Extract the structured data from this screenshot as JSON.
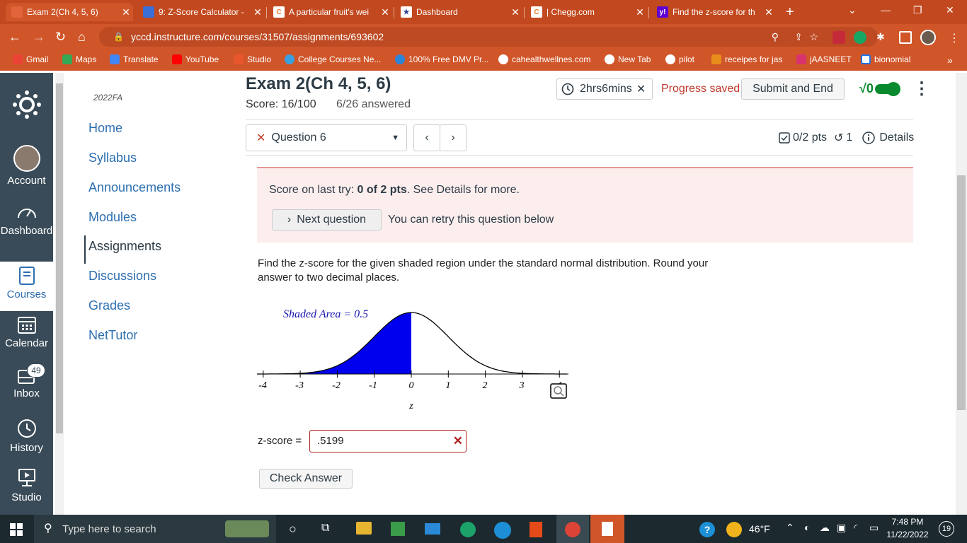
{
  "browser": {
    "tabs": [
      {
        "title": "Exam 2(Ch 4, 5, 6)",
        "color": "#e2643a",
        "glyph": ""
      },
      {
        "title": "9: Z-Score Calculator -",
        "color": "#3b6fd8",
        "glyph": ""
      },
      {
        "title": "A particular fruit's wei",
        "color": "#ee7b2d",
        "glyph": "C"
      },
      {
        "title": "Dashboard",
        "color": "#2c3e8f",
        "glyph": "★"
      },
      {
        "title": "| Chegg.com",
        "color": "#ee7b2d",
        "glyph": "C"
      },
      {
        "title": "Find the z-score for th",
        "color": "#6001d2",
        "glyph": "y!"
      }
    ],
    "url": "yccd.instructure.com/courses/31507/assignments/693602",
    "bookmarks": [
      "Gmail",
      "Maps",
      "Translate",
      "YouTube",
      "Studio",
      "College Courses Ne...",
      "100% Free DMV Pr...",
      "cahealthwellnes.com",
      "New Tab",
      "pilot",
      "receipes for jas",
      "jAASNEET",
      "bionomial"
    ]
  },
  "global_nav": {
    "account": "Account",
    "dashboard": "Dashboard",
    "courses": "Courses",
    "calendar": "Calendar",
    "inbox": "Inbox",
    "inbox_badge": "49",
    "history": "History",
    "studio": "Studio"
  },
  "course_nav": {
    "term": "2022FA",
    "items": [
      "Home",
      "Syllabus",
      "Announcements",
      "Modules",
      "Assignments",
      "Discussions",
      "Grades",
      "NetTutor"
    ]
  },
  "exam": {
    "title": "Exam 2(Ch 4, 5, 6)",
    "score": "Score: 16/100",
    "answered": "6/26 answered",
    "timer": "2hrs6mins",
    "progress": "Progress saved",
    "submit": "Submit and End",
    "sqrt": "√0"
  },
  "question": {
    "selector": "Question 6",
    "pts": "0/2 pts",
    "retries": "1",
    "details": "Details",
    "feedback_prefix": "Score on last try: ",
    "feedback_bold": "0 of 2 pts",
    "feedback_suffix": ". See Details for more.",
    "next": "Next question",
    "retry_note": "You can retry this question below",
    "prompt_line1": "Find the z-score for the given shaded region under the standard normal distribution. Round your",
    "prompt_line2": "answer to two decimal places.",
    "graph_label": "Shaded Area = 0.5",
    "axis_label": "z",
    "ticks": [
      "-4",
      "-3",
      "-2",
      "-1",
      "0",
      "1",
      "2",
      "3",
      "4"
    ],
    "answer_label": "z-score =",
    "answer_value": ".5199",
    "check": "Check Answer"
  },
  "taskbar": {
    "search": "Type here to search",
    "weather": "46°F",
    "time": "7:48 PM",
    "date": "11/22/2022",
    "notif": "19"
  }
}
